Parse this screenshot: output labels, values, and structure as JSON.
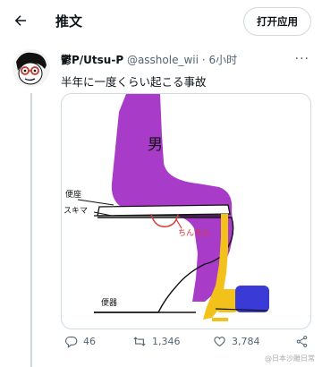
{
  "header": {
    "title": "推文",
    "open_app_label": "打开应用"
  },
  "tweet": {
    "display_name": "鬱P/Utsu-P",
    "handle": "@asshole_wii",
    "separator": "·",
    "time": "6小时",
    "text": "半年に一度くらい起こる事故",
    "media": {
      "label_man": "男",
      "label_seat": "便座",
      "label_gap": "スキマ",
      "label_chinchin": "ちんちん",
      "label_toilet": "便器"
    }
  },
  "actions": {
    "replies": "46",
    "retweets": "1,346",
    "likes": "3,784"
  },
  "watermark": "@日本沙雕日常",
  "colors": {
    "accent_purple": "#a83cc8",
    "pee_yellow": "#f2c21a",
    "shoe_blue": "#3a3ad6",
    "annotation_red": "#d83a3a"
  }
}
